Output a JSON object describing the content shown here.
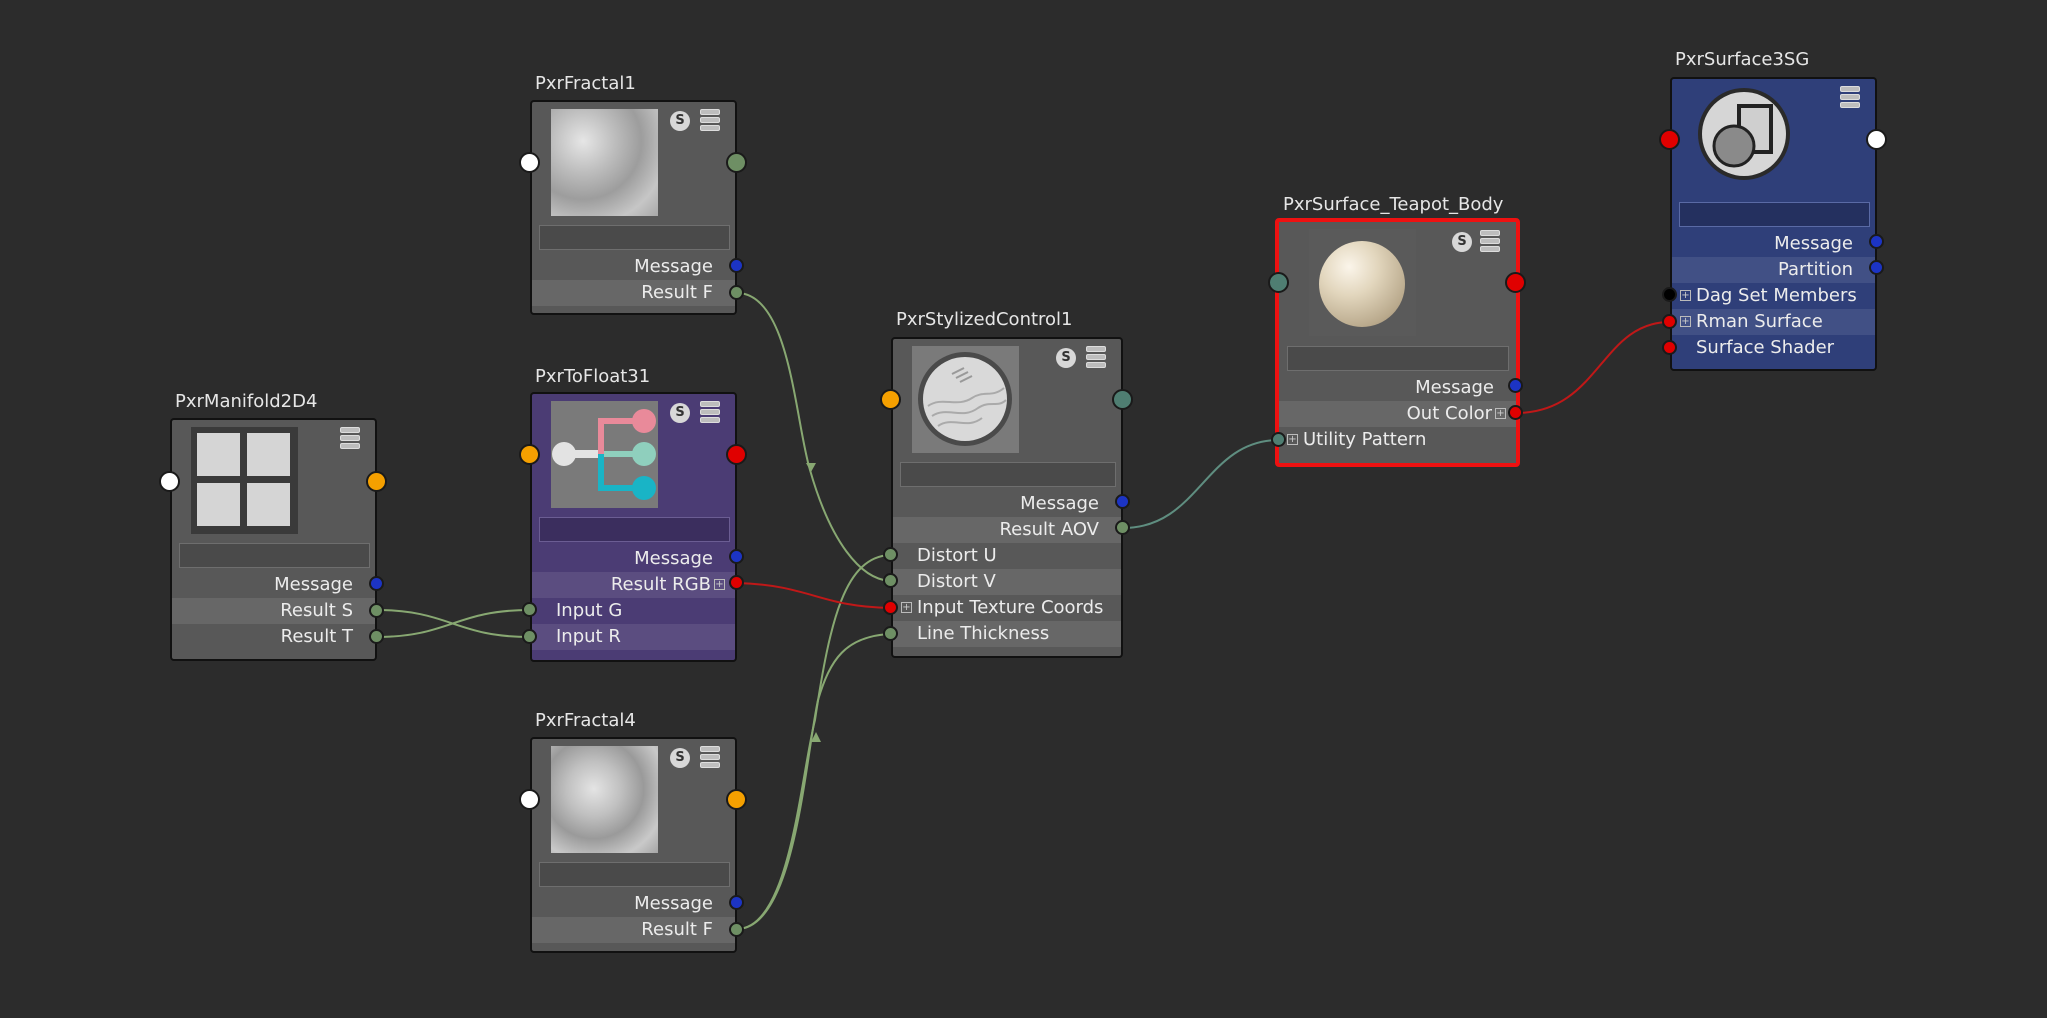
{
  "colors": {
    "canvas": "#2c2c2c",
    "node_gray": "#585858",
    "node_purple": "#4b3c74",
    "node_blue": "#2f3f79",
    "selected_outline": "#ee1111",
    "wire_green": "#88a872",
    "wire_red": "#c01818",
    "wire_teal": "#5f8e80",
    "port_green": "#6e8f64",
    "port_blue": "#1c34c4",
    "port_red": "#e00000",
    "port_orange": "#f5a000",
    "port_white": "#ffffff",
    "port_teal": "#4f7e72",
    "port_black": "#000000"
  },
  "nodes": {
    "fractal1": {
      "title": "PxrFractal1",
      "s_label": "S",
      "thumb_icon": "fractal-noise-icon",
      "outputs": [
        "Message",
        "Result F"
      ]
    },
    "tofloat3": {
      "title": "PxrToFloat31",
      "s_label": "S",
      "thumb_icon": "split-channels-icon",
      "outputs": [
        "Message",
        "Result RGB"
      ],
      "inputs": [
        "Input G",
        "Input R"
      ]
    },
    "manifold": {
      "title": "PxrManifold2D4",
      "thumb_icon": "grid-tiles-icon",
      "outputs": [
        "Message",
        "Result S",
        "Result T"
      ]
    },
    "fractal4": {
      "title": "PxrFractal4",
      "s_label": "S",
      "thumb_icon": "fractal-noise-icon",
      "outputs": [
        "Message",
        "Result F"
      ]
    },
    "stylized": {
      "title": "PxrStylizedControl1",
      "s_label": "S",
      "thumb_icon": "stylized-sphere-icon",
      "outputs": [
        "Message",
        "Result AOV"
      ],
      "inputs": [
        "Distort U",
        "Distort V",
        "Input Texture Coords",
        "Line Thickness"
      ]
    },
    "surface": {
      "title": "PxrSurface_Teapot_Body",
      "s_label": "S",
      "thumb_icon": "shaded-sphere-icon",
      "outputs": [
        "Message",
        "Out Color"
      ],
      "inputs": [
        "Utility Pattern"
      ]
    },
    "sg": {
      "title": "PxrSurface3SG",
      "thumb_icon": "shading-group-icon",
      "outputs": [
        "Message",
        "Partition"
      ],
      "inputs": [
        "Dag Set Members",
        "Rman Surface",
        "Surface Shader"
      ]
    }
  }
}
